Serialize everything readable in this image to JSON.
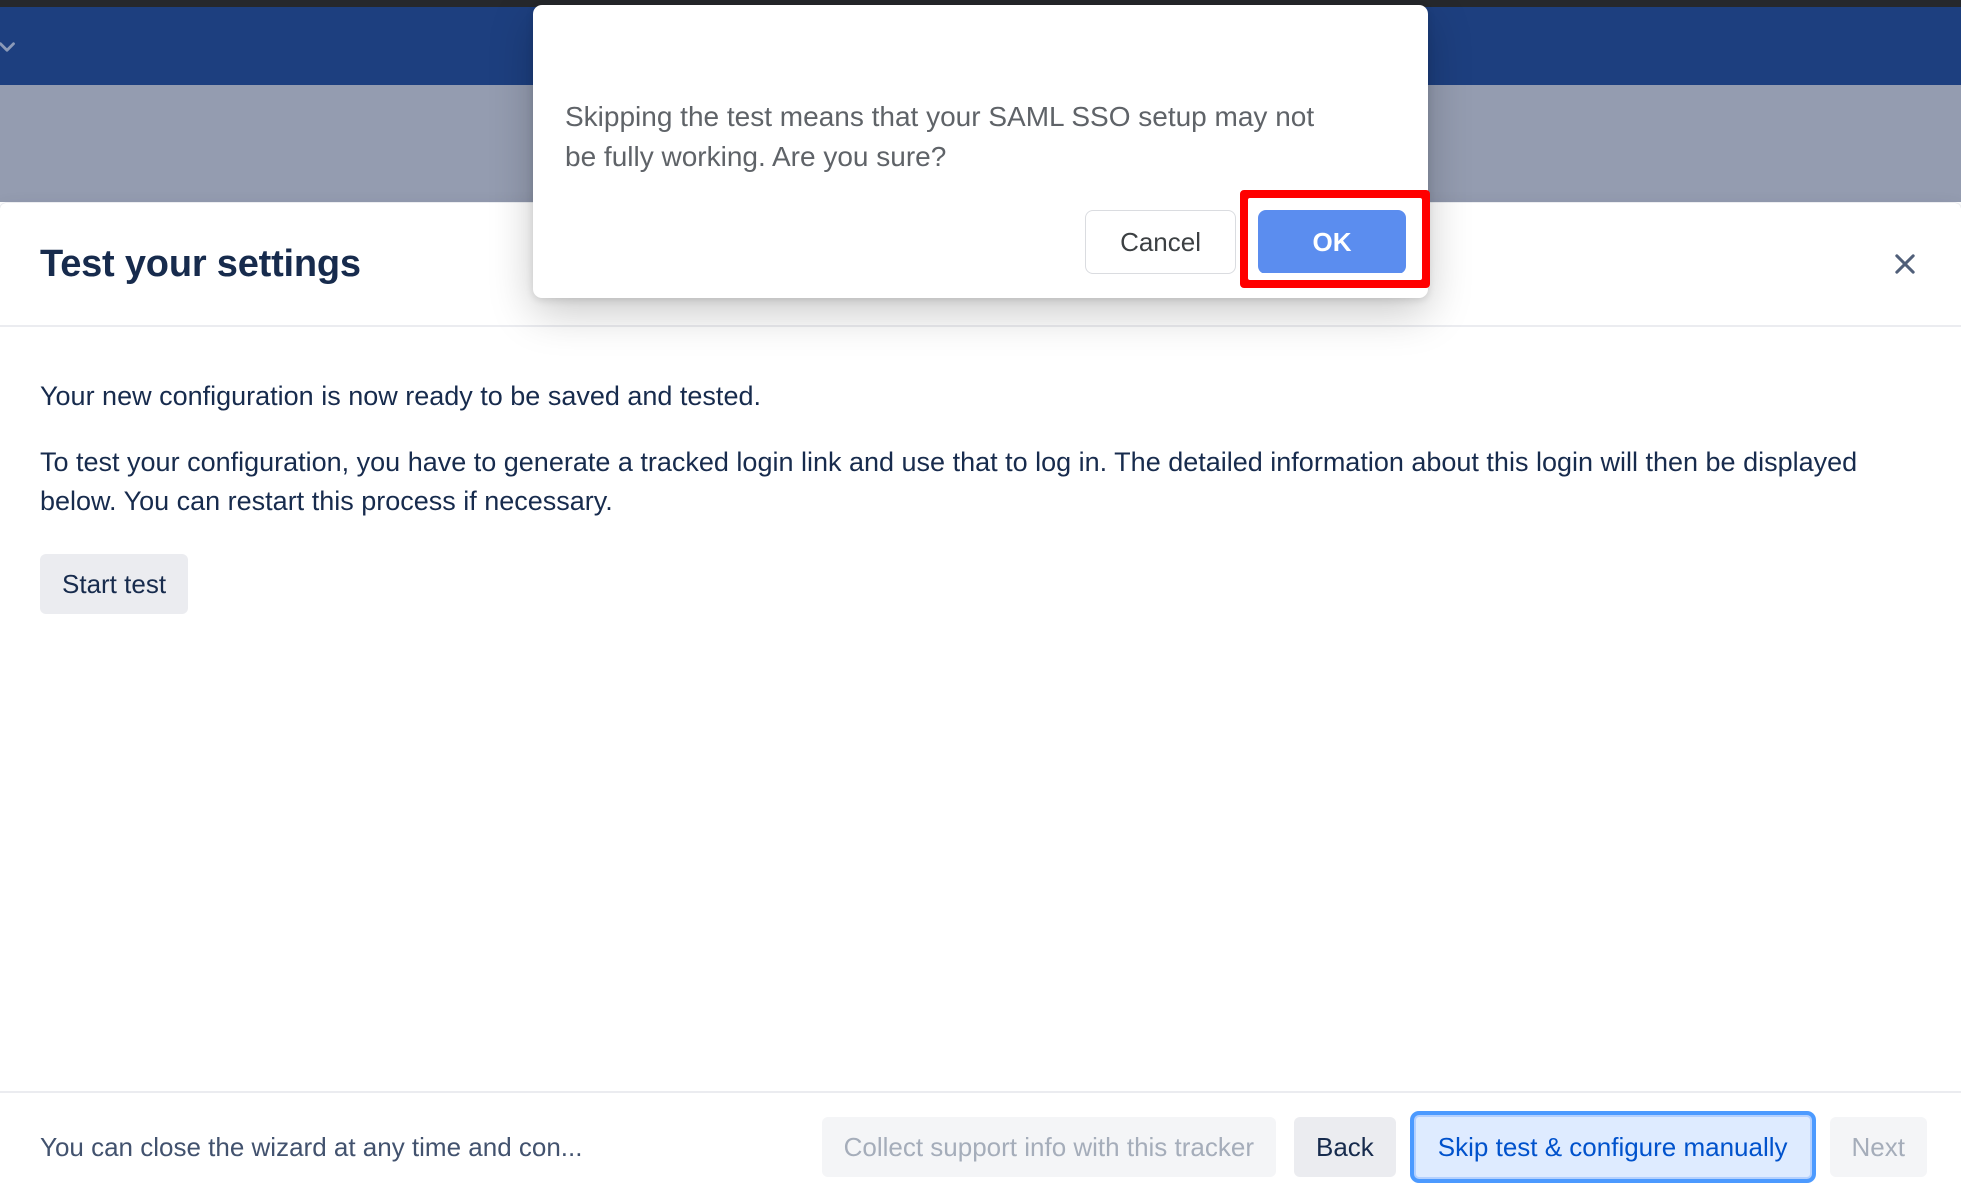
{
  "navbar": {
    "chevron_icon": "chevron-down-icon"
  },
  "wizard": {
    "title": "Test your settings",
    "close_icon": "close-icon",
    "paragraph_1": "Your new configuration is now ready to be saved and tested.",
    "paragraph_2": "To test your configuration, you have to generate a tracked login link and use that to log in. The detailed information about this login will then be displayed below. You can restart this process if necessary.",
    "start_test_label": "Start test",
    "footer": {
      "note": "You can close the wizard at any time and con...",
      "collect_support_label": "Collect support info with this tracker",
      "back_label": "Back",
      "skip_label": "Skip test & configure manually",
      "next_label": "Next"
    }
  },
  "alert": {
    "message": "Skipping the test means that your SAML SSO setup may not be fully working. Are you sure?",
    "cancel_label": "Cancel",
    "ok_label": "OK"
  },
  "colors": {
    "navbar": "#1d3f7f",
    "subbar": "#949cb0",
    "chrome": "#26282c",
    "text_primary": "#172b4d",
    "text_muted": "#42526e",
    "alert_text": "#5f6368",
    "ok_blue": "#5b8def",
    "link_blue": "#0052cc",
    "focus_blue": "#4c9aff",
    "focus_bg": "#deebff",
    "subtle_bg": "#ebecf0",
    "disabled_bg": "#f4f5f7",
    "disabled_text": "#a5adba",
    "highlight_red": "#ff0000"
  }
}
